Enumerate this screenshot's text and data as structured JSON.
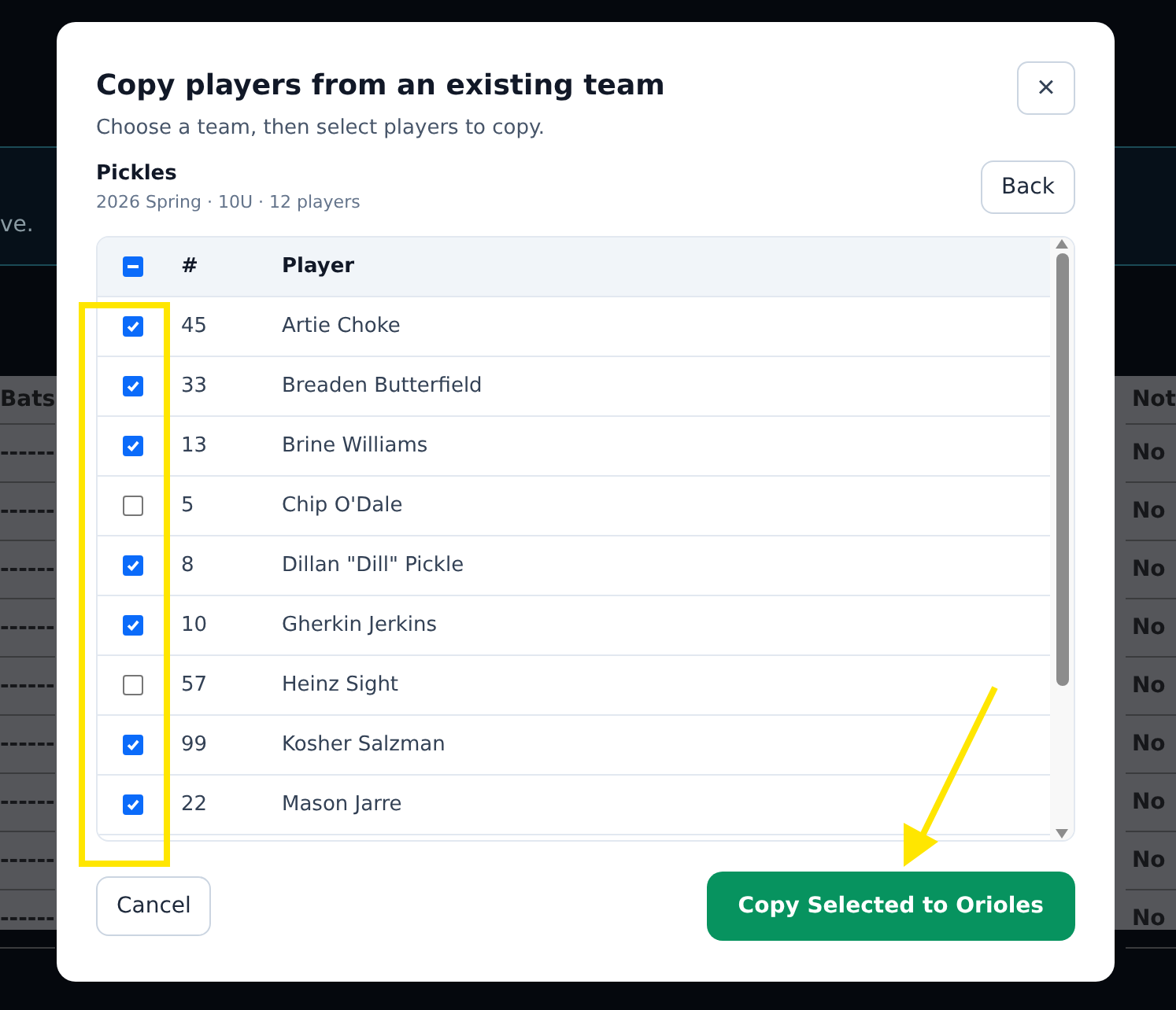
{
  "background": {
    "banner_text": "ve.",
    "table": {
      "left_column": {
        "header": "Bats",
        "cells": [
          "------",
          "------",
          "------",
          "------",
          "------",
          "------",
          "------",
          "------",
          "------"
        ]
      },
      "right_column": {
        "header": "Not",
        "cells": [
          "No",
          "No",
          "No",
          "No",
          "No",
          "No",
          "No",
          "No",
          "No"
        ]
      }
    }
  },
  "dialog": {
    "title": "Copy players from an existing team",
    "subtitle": "Choose a team, then select players to copy.",
    "close_label": "×",
    "team": {
      "name": "Pickles",
      "meta": "2026 Spring · 10U · 12 players"
    },
    "back_button": "Back",
    "table": {
      "select_all": {
        "indeterminate": true
      },
      "columns": [
        "#",
        "Player"
      ],
      "rows": [
        {
          "checked": true,
          "number": "45",
          "player": "Artie Choke"
        },
        {
          "checked": true,
          "number": "33",
          "player": "Breaden Butterfield"
        },
        {
          "checked": true,
          "number": "13",
          "player": "Brine Williams"
        },
        {
          "checked": false,
          "number": "5",
          "player": "Chip O'Dale"
        },
        {
          "checked": true,
          "number": "8",
          "player": "Dillan \"Dill\" Pickle"
        },
        {
          "checked": true,
          "number": "10",
          "player": "Gherkin Jerkins"
        },
        {
          "checked": false,
          "number": "57",
          "player": "Heinz Sight"
        },
        {
          "checked": true,
          "number": "99",
          "player": "Kosher Salzman"
        },
        {
          "checked": true,
          "number": "22",
          "player": "Mason Jarre"
        }
      ]
    },
    "cancel_button": "Cancel",
    "confirm_button": "Copy Selected to Orioles"
  }
}
